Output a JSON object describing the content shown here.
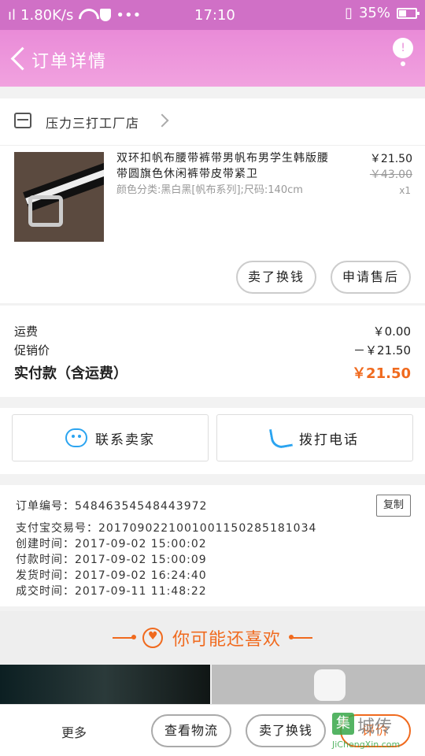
{
  "status_bar": {
    "network_speed": "1.80K/s",
    "time": "17:10",
    "battery": "35%"
  },
  "header": {
    "title": "订单详情",
    "menu_badge": "!"
  },
  "shop": {
    "name": "压力三打工厂店"
  },
  "product": {
    "title": "双环扣帆布腰带裤带男帆布男学生韩版腰带圆旗色休闲裤带皮带紧卫",
    "sku": "颜色分类:黑白黑[帆布系列];尺码:140cm",
    "price": "￥21.50",
    "original_price": "￥43.00",
    "quantity": "x1",
    "btn_resell": "卖了换钱",
    "btn_after_sale": "申请售后"
  },
  "fees": {
    "shipping_label": "运费",
    "shipping_value": "￥0.00",
    "promo_label": "促销价",
    "promo_value": "－￥21.50",
    "total_label": "实付款（含运费）",
    "total_value": "￥21.50"
  },
  "contact": {
    "seller_label": "联系卖家",
    "phone_label": "拨打电话"
  },
  "order_info": {
    "order_no": "订单编号：54846354548443972",
    "copy_label": "复制",
    "alipay_no": "支付宝交易号：2017090221001001150285181034",
    "created": "创建时间：2017-09-02 15:00:02",
    "paid": "付款时间：2017-09-02 15:00:09",
    "shipped": "发货时间：2017-09-02 16:24:40",
    "completed": "成交时间：2017-09-11 11:48:22"
  },
  "recommend": {
    "title": "你可能还喜欢"
  },
  "bottom_bar": {
    "more": "更多",
    "logistics": "查看物流",
    "resell": "卖了换钱",
    "review": "评价"
  },
  "watermark": {
    "badge": "集",
    "text": "城传",
    "url": "JiChengXin.com"
  },
  "colors": {
    "header": "#e98bd8",
    "accent": "#f06a1e",
    "icon_blue": "#2ba4f0"
  }
}
